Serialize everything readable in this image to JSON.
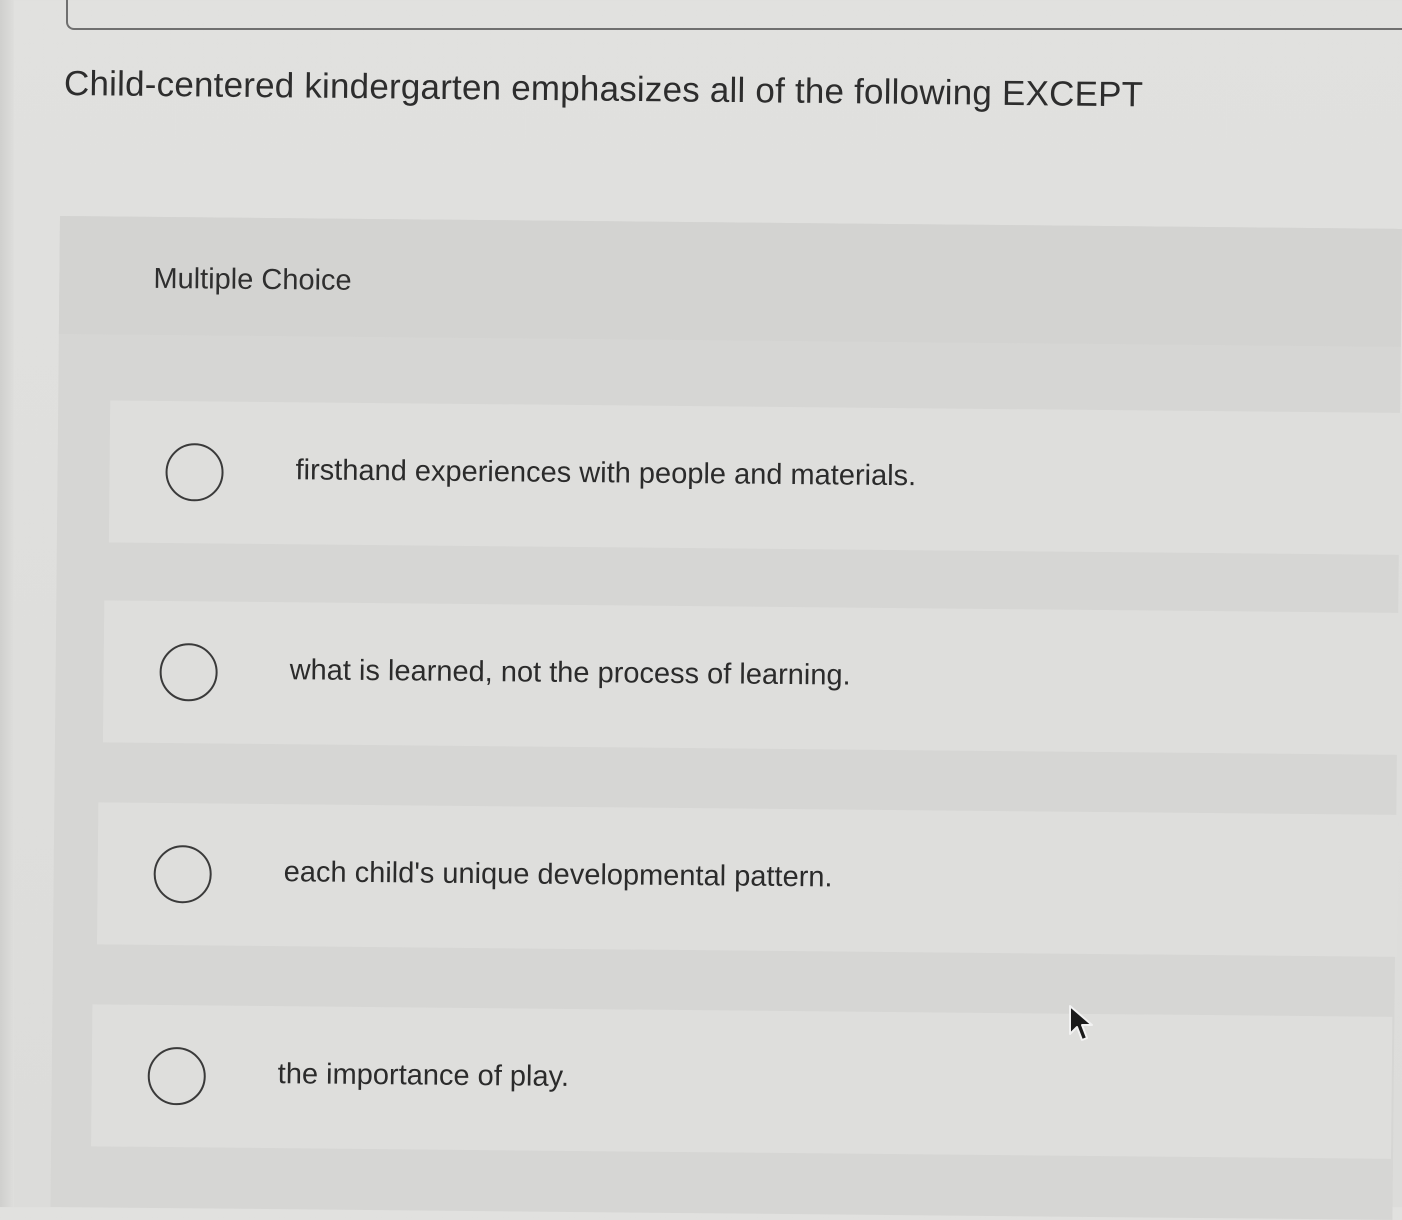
{
  "question": {
    "text": "Child-centered kindergarten emphasizes all of the following EXCEPT"
  },
  "question_type": {
    "label": "Multiple Choice"
  },
  "choices": [
    {
      "label": "firsthand experiences with people and materials.",
      "selected": false
    },
    {
      "label": "what is learned, not the process of learning.",
      "selected": false
    },
    {
      "label": "each child's unique developmental pattern.",
      "selected": false
    },
    {
      "label": "the importance of play.",
      "selected": false
    }
  ],
  "icons": {
    "radio": "radio-button-empty-icon",
    "cursor": "mouse-pointer-icon"
  },
  "colors": {
    "background": "#e1e1df",
    "panel": "#d6d6d4",
    "choice_row": "#dededc",
    "text": "#2b2b2b"
  }
}
